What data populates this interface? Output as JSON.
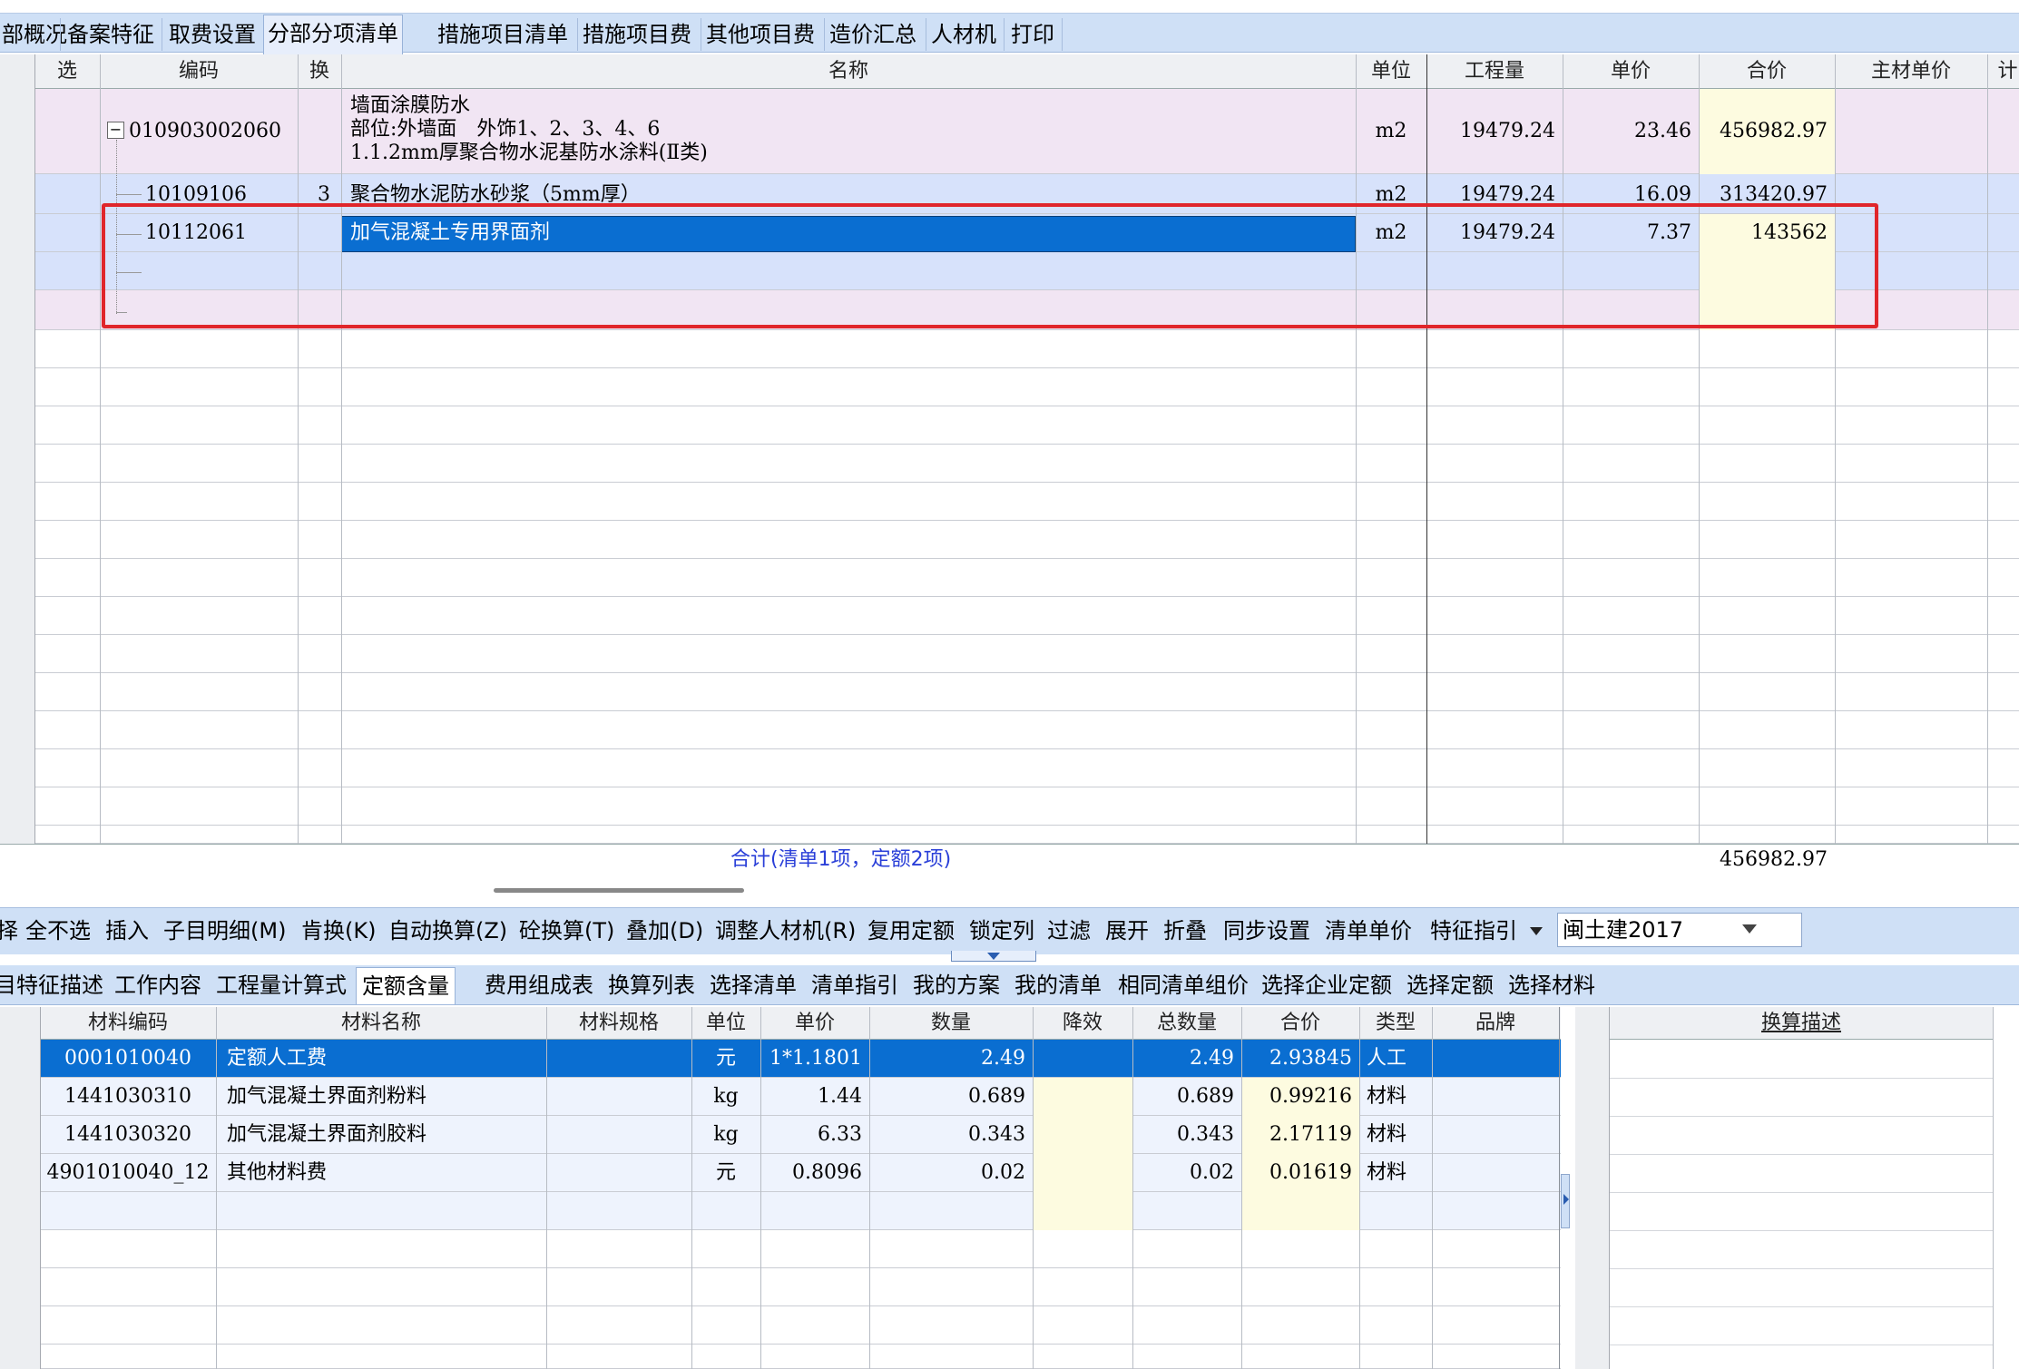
{
  "top_tabs": [
    "部概况",
    "备案特征",
    "取费设置",
    "分部分项清单",
    "措施项目清单",
    "措施项目费",
    "其他项目费",
    "造价汇总",
    "人材机",
    "打印"
  ],
  "grid": {
    "headers": {
      "select": "选",
      "code": "编码",
      "swap": "换",
      "name": "名称",
      "unit": "单位",
      "qty": "工程量",
      "price": "单价",
      "total": "合价",
      "main_price": "主材单价",
      "edge": "计"
    },
    "bill_row": {
      "collapse_glyph": "−",
      "code": "010903002060",
      "name_lines": [
        "墙面涂膜防水",
        "部位:外墙面　外饰1、2、3、4、6",
        "1.1.2mm厚聚合物水泥基防水涂料(Ⅱ类)"
      ],
      "unit": "m2",
      "qty": "19479.24",
      "price": "23.46",
      "total": "456982.97"
    },
    "sub_rows": [
      {
        "code": "10109106",
        "swap": "3",
        "name": "聚合物水泥防水砂浆（5mm厚）",
        "unit": "m2",
        "qty": "19479.24",
        "price": "16.09",
        "total": "313420.97"
      },
      {
        "code": "10112061",
        "swap": "",
        "name": "加气混凝土专用界面剂",
        "unit": "m2",
        "qty": "19479.24",
        "price": "7.37",
        "total": "143562"
      }
    ],
    "summary_label": "合计(清单1项，定额2项)",
    "summary_total": "456982.97"
  },
  "toolbar": {
    "buttons": [
      "择",
      "全不选",
      "插入",
      "子目明细(M)",
      "肯换(K)",
      "自动换算(Z)",
      "砼换算(T)",
      "叠加(D)",
      "调整人材机(R)",
      "复用定额",
      "锁定列",
      "过滤",
      "展开",
      "折叠",
      "同步设置",
      "清单单价",
      "特征指引"
    ],
    "dropdown_value": "闽土建2017"
  },
  "lower_tabs": [
    "目特征描述",
    "工作内容",
    "工程量计算式",
    "定额含量",
    "费用组成表",
    "换算列表",
    "选择清单",
    "清单指引",
    "我的方案",
    "我的清单",
    "相同清单组价",
    "选择企业定额",
    "选择定额",
    "选择材料"
  ],
  "materials": {
    "headers": {
      "code": "材料编码",
      "name": "材料名称",
      "spec": "材料规格",
      "unit": "单位",
      "price": "单价",
      "qty": "数量",
      "reduce": "降效",
      "total_qty": "总数量",
      "total": "合价",
      "type": "类型",
      "brand": "品牌",
      "desc": "换算描述"
    },
    "rows": [
      {
        "code": "0001010040",
        "name": "定额人工费",
        "spec": "",
        "unit": "元",
        "price": "1*1.1801",
        "qty": "2.49",
        "reduce": "",
        "total_qty": "2.49",
        "total": "2.93845",
        "type": "人工",
        "brand": ""
      },
      {
        "code": "1441030310",
        "name": "加气混凝土界面剂粉料",
        "spec": "",
        "unit": "kg",
        "price": "1.44",
        "qty": "0.689",
        "reduce": "",
        "total_qty": "0.689",
        "total": "0.99216",
        "type": "材料",
        "brand": ""
      },
      {
        "code": "1441030320",
        "name": "加气混凝土界面剂胶料",
        "spec": "",
        "unit": "kg",
        "price": "6.33",
        "qty": "0.343",
        "reduce": "",
        "total_qty": "0.343",
        "total": "2.17119",
        "type": "材料",
        "brand": ""
      },
      {
        "code": "4901010040_12",
        "name": "其他材料费",
        "spec": "",
        "unit": "元",
        "price": "0.8096",
        "qty": "0.02",
        "reduce": "",
        "total_qty": "0.02",
        "total": "0.01619",
        "type": "材料",
        "brand": ""
      }
    ]
  },
  "colors": {
    "highlight_box": "#e0262b",
    "selection": "#0a6ed1",
    "bill_bg": "#f1e5f3",
    "sub_bg": "#d7e2fb",
    "yellow": "#fefce0",
    "toolbar": "#cfe0f6"
  }
}
